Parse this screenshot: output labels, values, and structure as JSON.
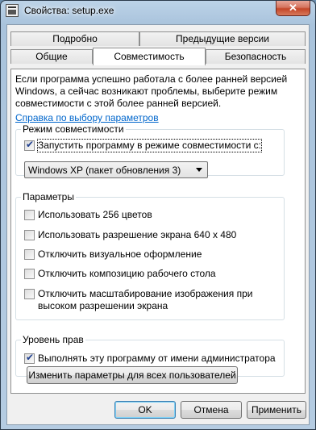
{
  "window": {
    "title": "Свойства: setup.exe",
    "close_label": "✕"
  },
  "tabs": {
    "row1": [
      {
        "label": "Подробно"
      },
      {
        "label": "Предыдущие версии"
      }
    ],
    "row2": [
      {
        "label": "Общие"
      },
      {
        "label": "Совместимость",
        "active": true
      },
      {
        "label": "Безопасность"
      }
    ]
  },
  "panel": {
    "intro": "Если программа успешно работала с более ранней версией Windows, а сейчас возникают проблемы, выберите режим совместимости с этой более ранней версией.",
    "help_link": "Справка по выбору параметров",
    "compat_group": {
      "legend": "Режим совместимости",
      "checkbox_label": "Запустить программу в режиме совместимости с:",
      "checked": true,
      "select_value": "Windows XP (пакет обновления 3)"
    },
    "settings_group": {
      "legend": "Параметры",
      "items": [
        {
          "label": "Использовать 256 цветов",
          "checked": false
        },
        {
          "label": "Использовать разрешение экрана 640 x 480",
          "checked": false
        },
        {
          "label": "Отключить визуальное оформление",
          "checked": false
        },
        {
          "label": "Отключить композицию рабочего стола",
          "checked": false
        },
        {
          "label_line1": "Отключить масштабирование изображения при",
          "label_line2": "высоком разрешении экрана",
          "checked": false
        }
      ]
    },
    "privilege_group": {
      "legend": "Уровень прав",
      "checkbox_label": "Выполнять эту программу от имени администратора",
      "checked": true
    },
    "all_users_button": "Изменить параметры для всех пользователей"
  },
  "footer": {
    "ok": "OK",
    "cancel": "Отмена",
    "apply": "Применить"
  }
}
